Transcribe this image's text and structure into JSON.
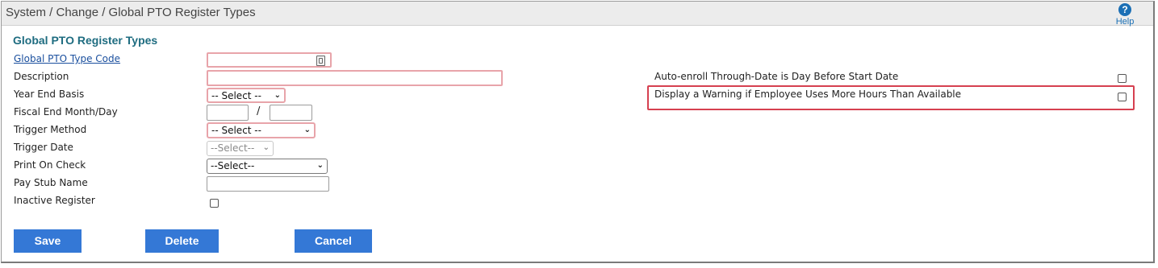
{
  "header": {
    "breadcrumb": "System / Change / Global PTO Register Types",
    "help_label": "Help",
    "help_icon": "help-circle-icon",
    "help_glyph": "?"
  },
  "form": {
    "title": "Global PTO Register Types",
    "labels": {
      "type_code": "Global PTO Type Code",
      "description": "Description",
      "year_end_basis": "Year End Basis",
      "fiscal_end": "Fiscal End Month/Day",
      "trigger_method": "Trigger Method",
      "trigger_date": "Trigger Date",
      "print_on_check": "Print On Check",
      "pay_stub_name": "Pay Stub Name",
      "inactive_register": "Inactive Register"
    },
    "values": {
      "type_code": "",
      "description": "",
      "year_end_basis": "-- Select --",
      "fiscal_month": "",
      "fiscal_day": "",
      "fiscal_separator": "/",
      "trigger_method": "-- Select --",
      "trigger_date": "--Select--",
      "print_on_check": "--Select--",
      "pay_stub_name": "",
      "inactive_register": false
    }
  },
  "options": {
    "auto_enroll_label": "Auto-enroll Through-Date is Day Before Start Date",
    "auto_enroll_checked": false,
    "warning_label": "Display a Warning if Employee Uses More Hours Than Available",
    "warning_checked": false
  },
  "buttons": {
    "save": "Save",
    "delete": "Delete",
    "cancel": "Cancel"
  },
  "colors": {
    "accent_button": "#3478d6",
    "title_teal": "#1e6c80",
    "required_border": "#e8a4aa",
    "highlight_red": "#d64050"
  }
}
